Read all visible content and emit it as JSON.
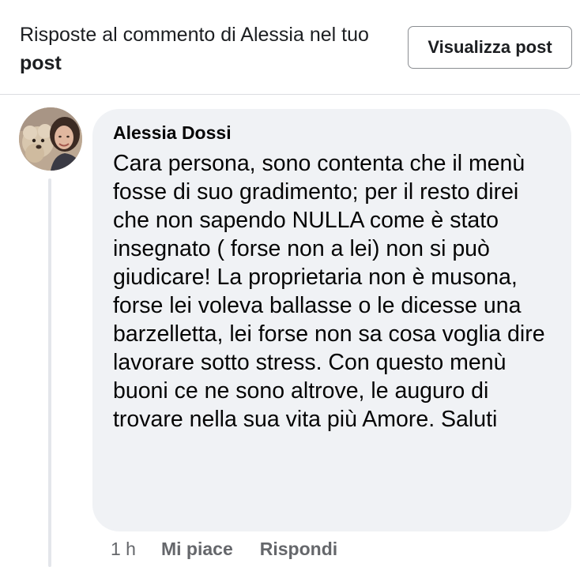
{
  "header": {
    "title_prefix": "Risposte al commento di Alessia nel tuo ",
    "title_bold": "post",
    "view_post_label": "Visualizza post"
  },
  "comment": {
    "author": "Alessia Dossi",
    "text": "Cara persona, sono contenta che il menù fosse di suo gradimento; per il resto direi che non sapendo NULLA come è stato insegnato ( forse non a lei) non si può giudicare! La proprietaria non è musona, forse lei voleva ballasse o le dicesse una barzelletta, lei forse non sa cosa voglia dire lavorare sotto stress. Con questo menù buoni ce ne sono altrove, le auguro di trovare nella sua vita più Amore. Saluti",
    "time": "1 h",
    "like_label": "Mi piace",
    "reply_label": "Rispondi"
  },
  "colors": {
    "bubble_bg": "#f0f2f5",
    "secondary_text": "#65676b",
    "divider": "#dcdde1"
  }
}
